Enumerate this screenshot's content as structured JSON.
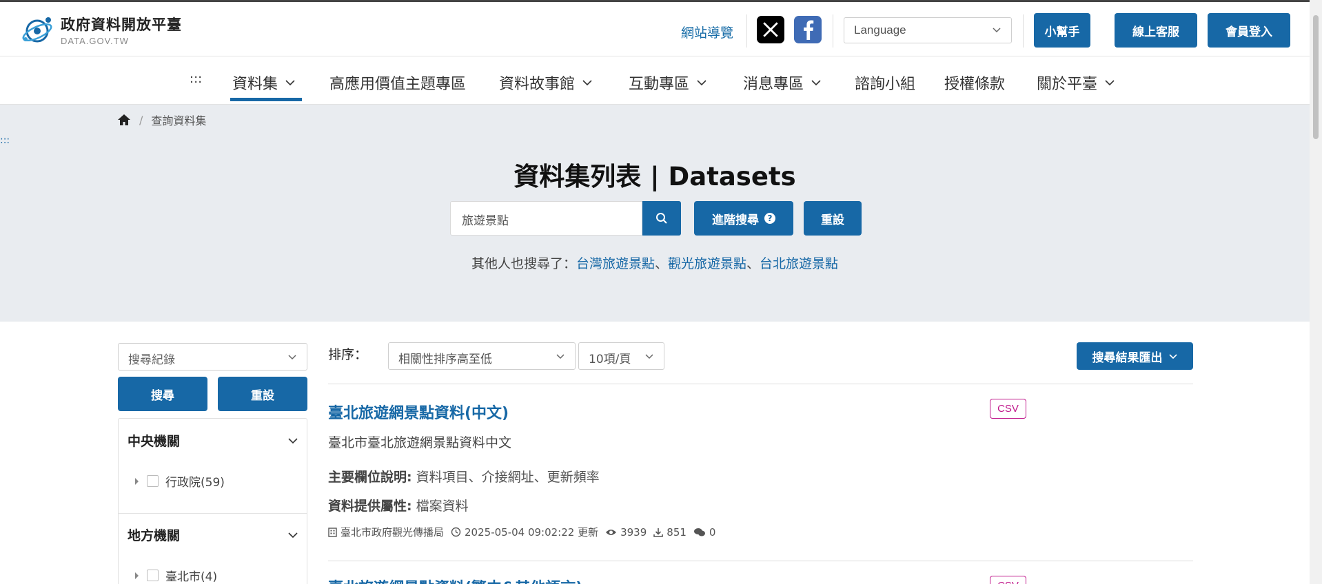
{
  "header": {
    "logo_title": "政府資料開放平臺",
    "logo_sub": "DATA.GOV.TW",
    "site_nav": "網站導覽",
    "language_placeholder": "Language",
    "helper_btn": "小幫手",
    "service_btn": "線上客服",
    "login_btn": "會員登入",
    "brand_color": "#1768a6"
  },
  "nav": {
    "dots": ":::",
    "items": [
      {
        "label": "資料集",
        "dropdown": true
      },
      {
        "label": "高應用價值主題專區",
        "dropdown": false
      },
      {
        "label": "資料故事館",
        "dropdown": true
      },
      {
        "label": "互動專區",
        "dropdown": true
      },
      {
        "label": "消息專區",
        "dropdown": true
      },
      {
        "label": "諮詢小組",
        "dropdown": false
      },
      {
        "label": "授權條款",
        "dropdown": false
      },
      {
        "label": "關於平臺",
        "dropdown": true
      }
    ]
  },
  "hero": {
    "breadcrumb_current": "查詢資料集",
    "side_dots": ":::",
    "title": "資料集列表 | Datasets",
    "search_value": "旅遊景點",
    "advanced_btn": "進階搜尋",
    "reset_btn": "重設",
    "also_label": "其他人也搜尋了：",
    "also_terms": [
      "台灣旅遊景點",
      "觀光旅遊景點",
      "台北旅遊景點"
    ],
    "also_sep": "、"
  },
  "sidebar": {
    "history_placeholder": "搜尋紀錄",
    "search_btn": "搜尋",
    "reset_btn": "重設",
    "facets": [
      {
        "title": "中央機關",
        "items": [
          {
            "label": "行政院(59)"
          }
        ]
      },
      {
        "title": "地方機關",
        "items": [
          {
            "label": "臺北市(4)"
          }
        ]
      }
    ]
  },
  "results": {
    "sort_label": "排序：",
    "sort_value": "相關性排序高至低",
    "per_page_value": "10項/頁",
    "export_btn": "搜尋結果匯出",
    "items": [
      {
        "title": "臺北旅遊網景點資料(中文)",
        "format": "CSV",
        "desc": "臺北市臺北旅遊網景點資料中文",
        "field_label": "主要欄位說明:",
        "field_value": "資料項目、介接網址、更新頻率",
        "attr_label": "資料提供屬性:",
        "attr_value": "檔案資料",
        "agency": "臺北市政府觀光傳播局",
        "updated": "2025-05-04 09:02:22 更新",
        "views": "3939",
        "downloads": "851",
        "comments": "0"
      },
      {
        "title": "臺北旅遊網景點資料(繁中&其他語言)",
        "format": "CSV"
      }
    ]
  }
}
